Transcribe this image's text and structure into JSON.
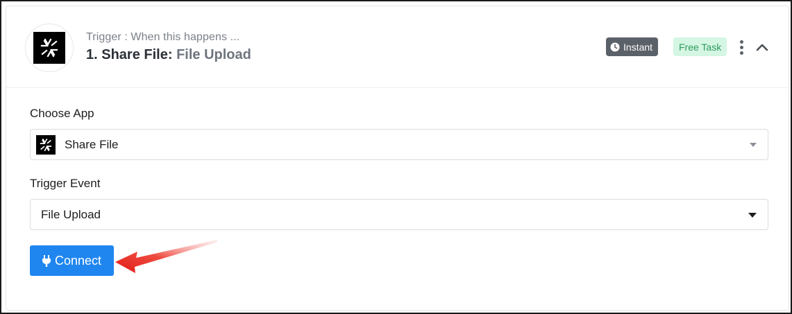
{
  "trigger": {
    "subtitle": "Trigger : When this happens ...",
    "title_prefix": "1. Share File:",
    "title_event": "File Upload",
    "app_icon": "share-file-logo"
  },
  "badges": {
    "instant": "Instant",
    "instant_icon": "clock-icon",
    "free_task": "Free Task"
  },
  "header_actions": {
    "more_icon": "kebab-menu-icon",
    "collapse_icon": "chevron-up-icon"
  },
  "form": {
    "choose_app": {
      "label": "Choose App",
      "value": "Share File",
      "icon": "share-file-logo"
    },
    "trigger_event": {
      "label": "Trigger Event",
      "value": "File Upload"
    },
    "connect_button": {
      "label": "Connect",
      "icon": "plug-icon"
    }
  },
  "annotation": {
    "arrow_color": "#e8201a"
  },
  "colors": {
    "primary": "#1f86f0",
    "instant_badge": "#5b6168",
    "free_badge_bg": "#d4f6e3",
    "free_badge_text": "#2f9a5c"
  }
}
